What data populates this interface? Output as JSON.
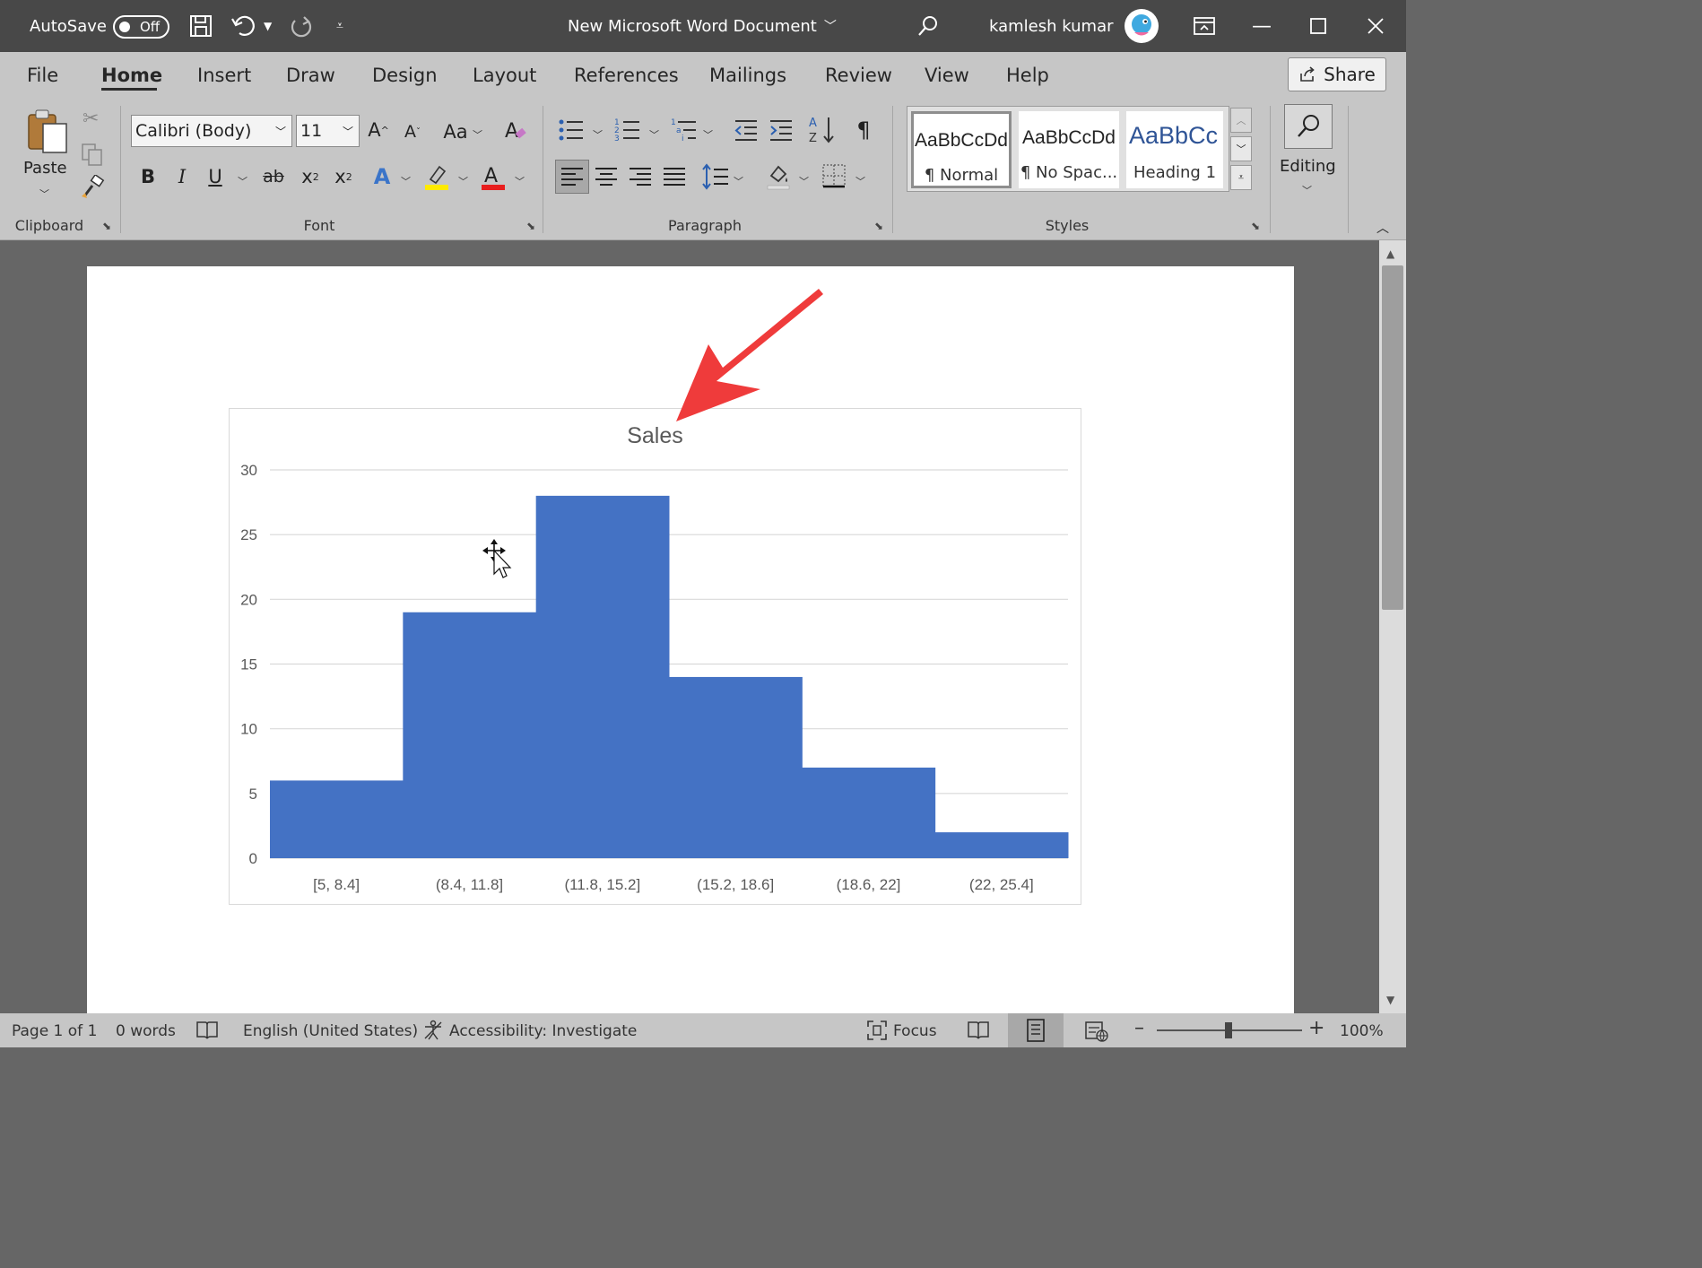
{
  "titlebar": {
    "autosave_label": "AutoSave",
    "autosave_state": "Off",
    "document_title": "New Microsoft Word Document",
    "user_name": "kamlesh kumar"
  },
  "ribbon": {
    "tabs": [
      {
        "label": "File"
      },
      {
        "label": "Home"
      },
      {
        "label": "Insert"
      },
      {
        "label": "Draw"
      },
      {
        "label": "Design"
      },
      {
        "label": "Layout"
      },
      {
        "label": "References"
      },
      {
        "label": "Mailings"
      },
      {
        "label": "Review"
      },
      {
        "label": "View"
      },
      {
        "label": "Help"
      }
    ],
    "active_tab": "Home",
    "share_label": "Share",
    "clipboard": {
      "paste_label": "Paste",
      "group_label": "Clipboard"
    },
    "font": {
      "name": "Calibri (Body)",
      "size": "11",
      "group_label": "Font",
      "change_case": "Aa"
    },
    "paragraph": {
      "group_label": "Paragraph"
    },
    "styles": {
      "group_label": "Styles",
      "items": [
        {
          "preview": "AaBbCcDd",
          "name": "¶ Normal"
        },
        {
          "preview": "AaBbCcDd",
          "name": "¶ No Spac..."
        },
        {
          "preview": "AaBbCc",
          "name": "Heading 1"
        }
      ]
    },
    "editing": {
      "label": "Editing"
    }
  },
  "chart_data": {
    "type": "bar",
    "title": "Sales",
    "categories": [
      "[5, 8.4]",
      "(8.4, 11.8]",
      "(11.8, 15.2]",
      "(15.2, 18.6]",
      "(18.6, 22]",
      "(22, 25.4]"
    ],
    "values": [
      6,
      19,
      28,
      14,
      7,
      2
    ],
    "ylim": [
      0,
      30
    ],
    "yticks": [
      0,
      5,
      10,
      15,
      20,
      25,
      30
    ],
    "grid": true,
    "bar_color": "#4472C4",
    "gap_width": 0
  },
  "statusbar": {
    "page": "Page 1 of 1",
    "words": "0 words",
    "language": "English (United States)",
    "accessibility": "Accessibility: Investigate",
    "focus": "Focus",
    "zoom": "100%"
  },
  "colors": {
    "titlebar_bg": "#484848",
    "ribbon_bg": "#c6c6c6",
    "canvas_bg": "#666666",
    "arrow": "#ef3b3b",
    "heading_blue": "#2f5496"
  }
}
